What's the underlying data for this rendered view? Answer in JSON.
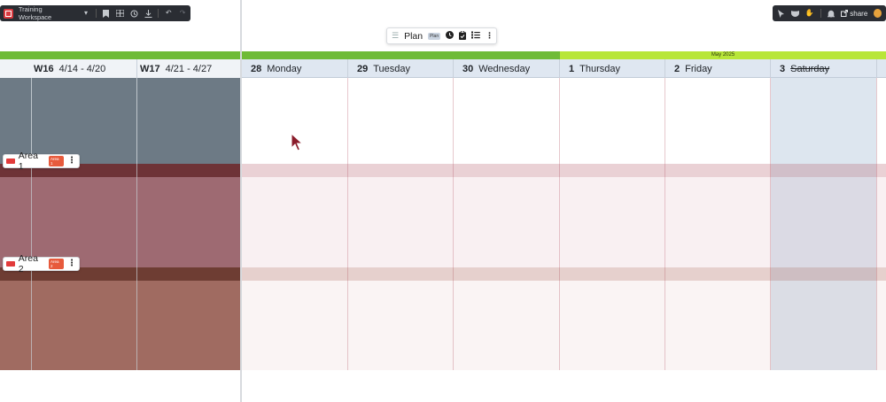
{
  "toolbar_left": {
    "workspace_name": "Training Workspace",
    "icons": [
      "app-logo",
      "dropdown-icon",
      "bookmark-icon",
      "grid-icon",
      "history-icon",
      "download-icon",
      "undo-icon",
      "redo-icon"
    ]
  },
  "toolbar_right": {
    "icons": [
      "cursor-icon",
      "mask-icon",
      "hand-icon",
      "bell-icon"
    ],
    "share_label": "share"
  },
  "plan_toolbar": {
    "title": "Plan",
    "badge": "Plan",
    "icons": [
      "list-toggle-icon",
      "clock-icon",
      "clipboard-icon",
      "checklist-icon",
      "more-vertical-icon"
    ]
  },
  "month_bar": {
    "label": "May 2025"
  },
  "header": {
    "weeks": [
      {
        "num": "W16",
        "range": "4/14 - 4/20"
      },
      {
        "num": "W17",
        "range": "4/21 - 4/27"
      }
    ],
    "days": [
      {
        "num": "28",
        "name": "Monday"
      },
      {
        "num": "29",
        "name": "Tuesday"
      },
      {
        "num": "30",
        "name": "Wednesday"
      },
      {
        "num": "1",
        "name": "Thursday"
      },
      {
        "num": "2",
        "name": "Friday"
      },
      {
        "num": "3",
        "name": "Saturday"
      }
    ]
  },
  "areas": [
    {
      "label": "Area 1",
      "tag": "Area 1"
    },
    {
      "label": "Area 2",
      "tag": "Area 2"
    }
  ],
  "colors": {
    "month_green": "#6fbb37",
    "month_lime": "#b8e639",
    "week_column": "#6d7a85",
    "area1_band_dark": "#6e3337",
    "area1_fill_dark": "#9e6a72",
    "area2_band_dark": "#6e3d33",
    "area2_fill_dark": "#a06b61",
    "accent_red": "#e23b3b"
  }
}
